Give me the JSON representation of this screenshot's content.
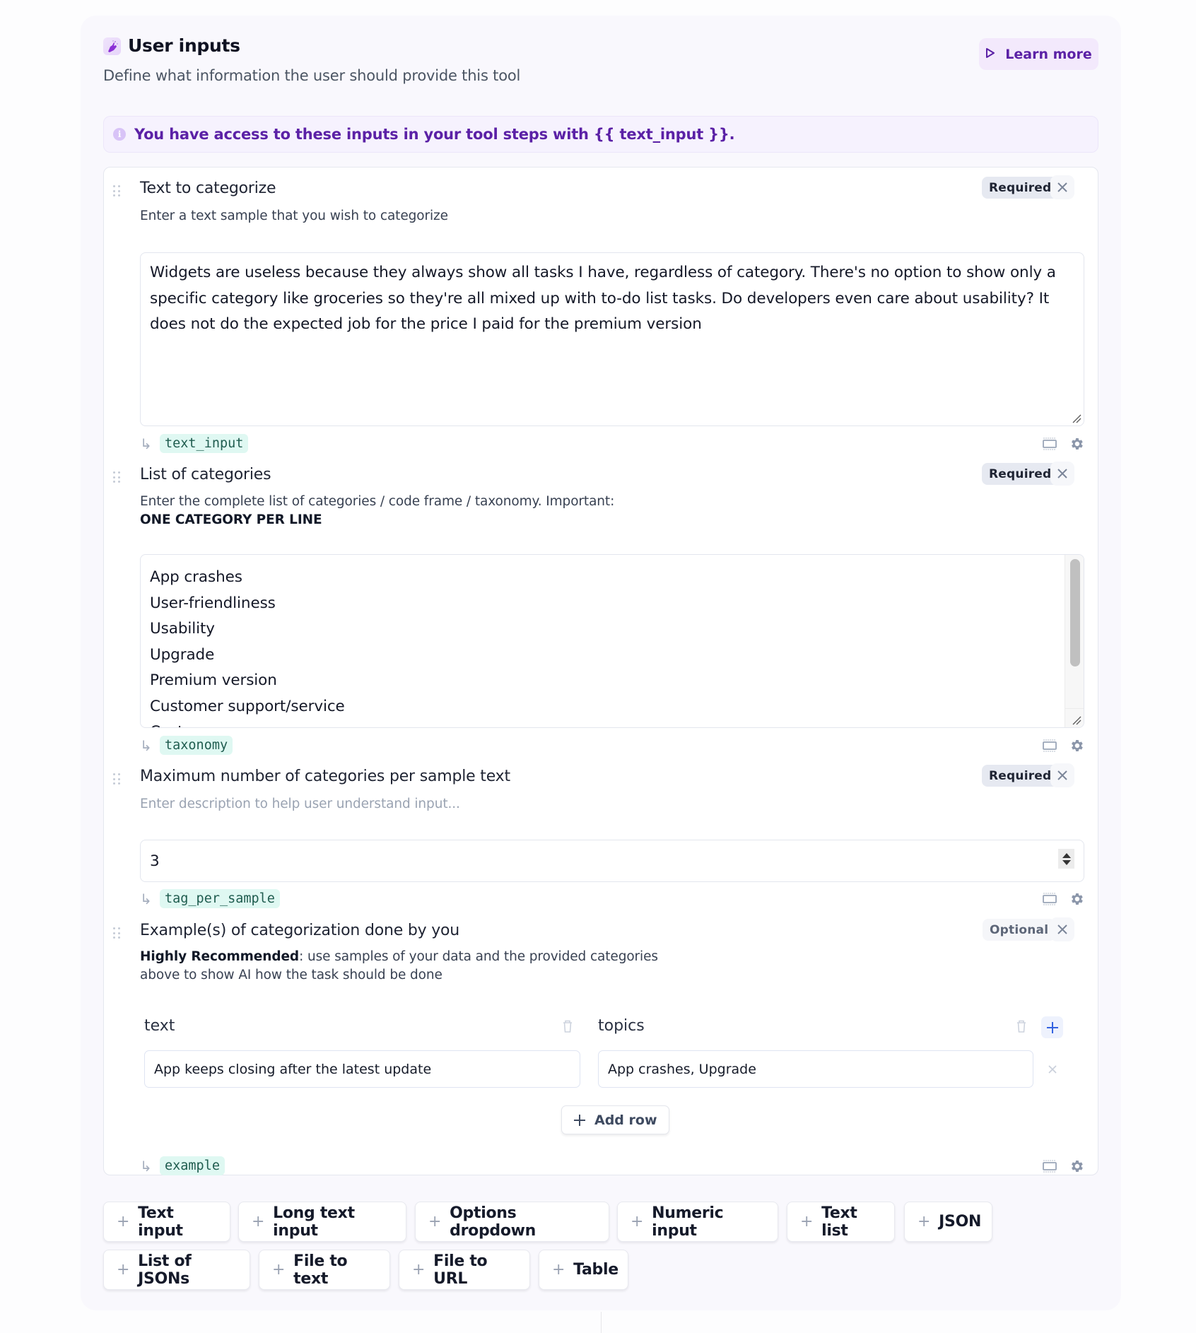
{
  "header": {
    "title": "User inputs",
    "subtitle": "Define what information the user should provide this tool",
    "learn_more_label": "Learn more",
    "accent_color": "#5b21a6"
  },
  "banner": {
    "icon": "info-icon",
    "text": "You have access to these inputs in your tool steps with {{ text_input }}."
  },
  "fields": [
    {
      "title": "Text to categorize",
      "description": "Enter a text sample that you wish to categorize",
      "badge": "Required",
      "value": "Widgets are useless because they always show all tasks I have, regardless of category. There's no option to show only a specific category like groceries so they're all mixed up with to-do list tasks. Do developers even care about usability? It does not do the expected job for the price I paid for the premium version",
      "variable": "text_input"
    },
    {
      "title": "List of categories",
      "description": "Enter the complete list of categories / code frame / taxonomy. Important:",
      "description_bold": "ONE CATEGORY PER LINE",
      "badge": "Required",
      "lines": [
        "App crashes",
        "User-friendliness",
        "Usability",
        "Upgrade",
        "Premium version",
        "Customer support/service",
        "Cost"
      ],
      "variable": "taxonomy"
    },
    {
      "title": "Maximum number of categories per sample text",
      "description_placeholder": "Enter description to help user understand input...",
      "badge": "Required",
      "value": "3",
      "variable": "tag_per_sample"
    },
    {
      "title": "Example(s) of categorization done by you",
      "description_bold": "Highly Recommended",
      "description": ": use samples of your data and the provided categories above to show AI how the task should be done",
      "badge": "Optional",
      "columns": [
        "text",
        "topics"
      ],
      "rows": [
        [
          "App keeps closing after the latest update",
          "App crashes, Upgrade"
        ]
      ],
      "add_row_label": "Add row",
      "variable": "example"
    }
  ],
  "add_input_types": [
    "Text input",
    "Long text input",
    "Options dropdown",
    "Numeric input",
    "Text list",
    "JSON",
    "List of JSONs",
    "File to text",
    "File to URL",
    "Table"
  ]
}
